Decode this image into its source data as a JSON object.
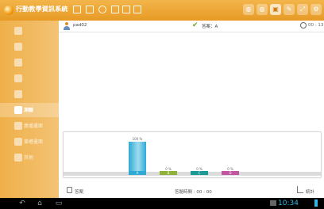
{
  "app": {
    "title": "行動教學資訊系統",
    "toolbar_icons": [
      "grid-icon",
      "list-icon",
      "refresh-icon",
      "document-icon",
      "document-icon",
      "list-icon"
    ],
    "right_icons": [
      "globe-icon",
      "globe-icon",
      "camera-icon",
      "chat-icon",
      "fullscreen-icon",
      "settings-icon"
    ],
    "active_right_index": 2
  },
  "sidebar": {
    "items": [
      {
        "label": "",
        "icon": "person-icon"
      },
      {
        "label": "",
        "icon": "person-icon"
      },
      {
        "label": "",
        "icon": "person-icon"
      },
      {
        "label": "",
        "icon": "line-icon"
      },
      {
        "label": "",
        "icon": "edit-icon"
      },
      {
        "label": "測驗",
        "icon": "menu-icon",
        "selected": true
      },
      {
        "label": "廣播畫面",
        "icon": "broadcast-icon"
      },
      {
        "label": "搶權畫面",
        "icon": "hand-icon"
      },
      {
        "label": "其他",
        "icon": "person-icon"
      }
    ]
  },
  "main": {
    "user_name": "pad02",
    "answer_text": "答案：A",
    "time_text": "00 : 13"
  },
  "chart_data": {
    "type": "bar",
    "categories": [
      "A",
      "B",
      "C",
      "D"
    ],
    "values": [
      100,
      10,
      10,
      10
    ],
    "value_labels": [
      "100 %",
      "0 %",
      "0 %",
      "0 %"
    ],
    "colors": [
      "#2eaad4",
      "#8fb339",
      "#1d9a96",
      "#c2559f"
    ]
  },
  "footer": {
    "answer_label": "答案",
    "elapsed_label": "答題時間 : 00 : 00",
    "stats_label": "統計"
  },
  "statusbar": {
    "clock": "10:34"
  }
}
